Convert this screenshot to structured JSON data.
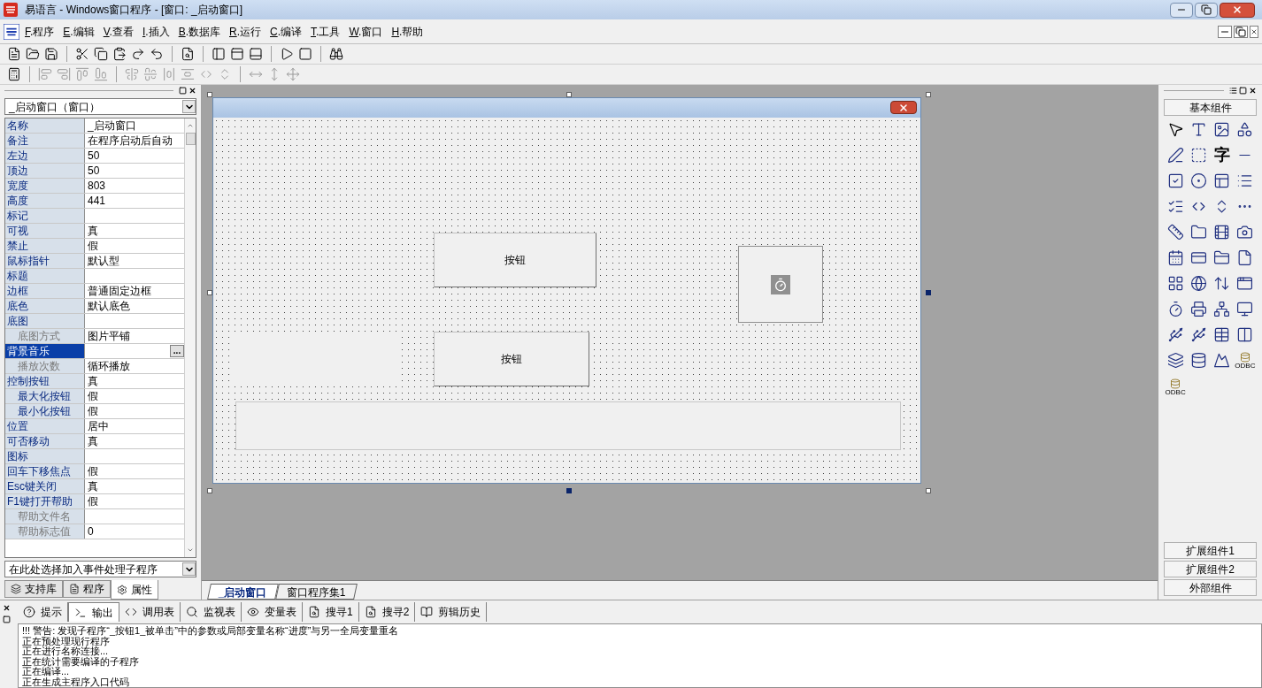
{
  "window": {
    "title": "易语言 - Windows窗口程序 - [窗口: _启动窗口]"
  },
  "menu": [
    "F.程序",
    "E.编辑",
    "V.查看",
    "I.插入",
    "B.数据库",
    "R.运行",
    "C.编译",
    "T.工具",
    "W.窗口",
    "H.帮助"
  ],
  "properties": {
    "object": "_启动窗口（窗口）",
    "rows": [
      {
        "name": "名称",
        "value": "_启动窗口",
        "indented": false,
        "disabled": false,
        "selected": false
      },
      {
        "name": "备注",
        "value": "在程序启动后自动",
        "indented": false,
        "disabled": false,
        "selected": false
      },
      {
        "name": "左边",
        "value": "50",
        "indented": false,
        "disabled": false,
        "selected": false
      },
      {
        "name": "顶边",
        "value": "50",
        "indented": false,
        "disabled": false,
        "selected": false
      },
      {
        "name": "宽度",
        "value": "803",
        "indented": false,
        "disabled": false,
        "selected": false
      },
      {
        "name": "高度",
        "value": "441",
        "indented": false,
        "disabled": false,
        "selected": false
      },
      {
        "name": "标记",
        "value": "",
        "indented": false,
        "disabled": false,
        "selected": false
      },
      {
        "name": "可视",
        "value": "真",
        "indented": false,
        "disabled": false,
        "selected": false
      },
      {
        "name": "禁止",
        "value": "假",
        "indented": false,
        "disabled": false,
        "selected": false
      },
      {
        "name": "鼠标指针",
        "value": "默认型",
        "indented": false,
        "disabled": false,
        "selected": false
      },
      {
        "name": "标题",
        "value": "",
        "indented": false,
        "disabled": false,
        "selected": false
      },
      {
        "name": "边框",
        "value": "普通固定边框",
        "indented": false,
        "disabled": false,
        "selected": false
      },
      {
        "name": "底色",
        "value": "默认底色",
        "indented": false,
        "disabled": false,
        "selected": false
      },
      {
        "name": "底图",
        "value": "",
        "indented": false,
        "disabled": false,
        "selected": false
      },
      {
        "name": "底图方式",
        "value": "图片平铺",
        "indented": true,
        "disabled": true,
        "selected": false
      },
      {
        "name": "背景音乐",
        "value": "",
        "indented": false,
        "disabled": false,
        "selected": true,
        "button_label": "..."
      },
      {
        "name": "播放次数",
        "value": "循环播放",
        "indented": true,
        "disabled": true,
        "selected": false
      },
      {
        "name": "控制按钮",
        "value": "真",
        "indented": false,
        "disabled": false,
        "selected": false
      },
      {
        "name": "最大化按钮",
        "value": "假",
        "indented": true,
        "disabled": false,
        "selected": false
      },
      {
        "name": "最小化按钮",
        "value": "假",
        "indented": true,
        "disabled": false,
        "selected": false
      },
      {
        "name": "位置",
        "value": "居中",
        "indented": false,
        "disabled": false,
        "selected": false
      },
      {
        "name": "可否移动",
        "value": "真",
        "indented": false,
        "disabled": false,
        "selected": false
      },
      {
        "name": "图标",
        "value": "",
        "indented": false,
        "disabled": false,
        "selected": false
      },
      {
        "name": "回车下移焦点",
        "value": "假",
        "indented": false,
        "disabled": false,
        "selected": false
      },
      {
        "name": "Esc键关闭",
        "value": "真",
        "indented": false,
        "disabled": false,
        "selected": false
      },
      {
        "name": "F1键打开帮助",
        "value": "假",
        "indented": false,
        "disabled": false,
        "selected": false
      },
      {
        "name": "帮助文件名",
        "value": "",
        "indented": true,
        "disabled": true,
        "selected": false
      },
      {
        "name": "帮助标志值",
        "value": "0",
        "indented": true,
        "disabled": true,
        "selected": false
      }
    ],
    "event_selector": "在此处选择加入事件处理子程序"
  },
  "left_tabs": [
    {
      "label": "支持库",
      "selected": false
    },
    {
      "label": "程序",
      "selected": false
    },
    {
      "label": "属性",
      "selected": true
    }
  ],
  "designer": {
    "buttons": [
      "按钮",
      "按钮"
    ]
  },
  "editor_tabs": [
    {
      "label": "_启动窗口",
      "selected": true
    },
    {
      "label": "窗口程序集1",
      "selected": false
    }
  ],
  "palette": {
    "sections_top": [
      "基本组件"
    ],
    "char_tile": "字",
    "odbc_tiles": [
      "ODBC",
      "ODBC"
    ],
    "sections_bottom": [
      "扩展组件1",
      "扩展组件2",
      "外部组件"
    ]
  },
  "output_tabs": [
    {
      "label": "提示",
      "selected": false
    },
    {
      "label": "输出",
      "selected": true
    },
    {
      "label": "调用表",
      "selected": false
    },
    {
      "label": "监视表",
      "selected": false
    },
    {
      "label": "变量表",
      "selected": false
    },
    {
      "label": "搜寻1",
      "selected": false
    },
    {
      "label": "搜寻2",
      "selected": false
    },
    {
      "label": "剪辑历史",
      "selected": false
    }
  ],
  "output_lines": [
    "!!! 警告:  发现子程序“_按钮1_被单击”中的参数或局部变量名称“进度”与另一全局变量重名",
    "正在预处理现行程序",
    "正在进行名称连接...",
    "正在统计需要编译的子程序",
    "正在编译...",
    "正在生成主程序入口代码"
  ]
}
